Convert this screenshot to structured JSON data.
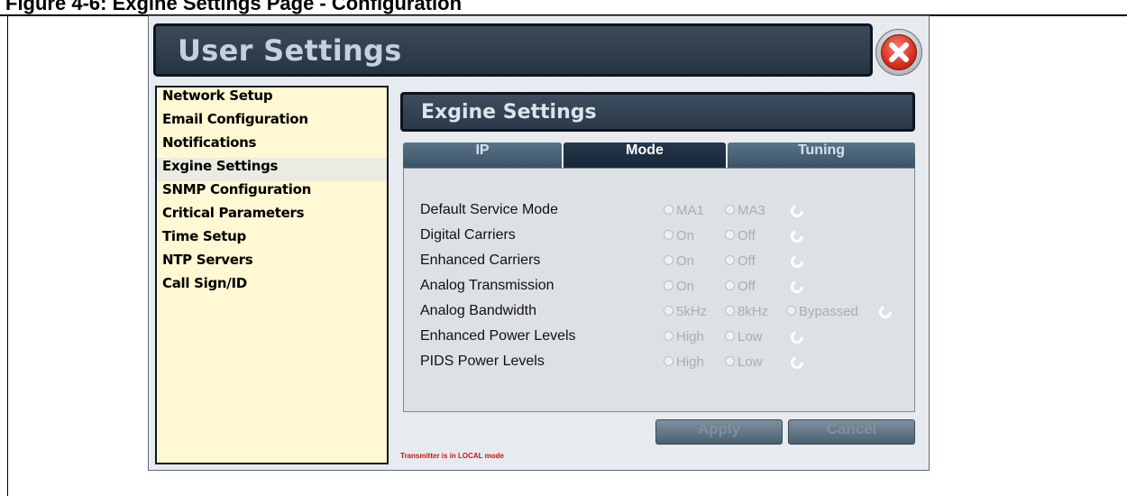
{
  "caption": "Figure 4-6: Exgine Settings Page - Configuration",
  "app": {
    "title": "User Settings",
    "close_icon": "close-icon"
  },
  "sidebar": {
    "items": [
      {
        "label": "Network Setup",
        "selected": false
      },
      {
        "label": "Email Configuration",
        "selected": false
      },
      {
        "label": "Notifications",
        "selected": false
      },
      {
        "label": "Exgine Settings",
        "selected": true
      },
      {
        "label": "SNMP Configuration",
        "selected": false
      },
      {
        "label": "Critical Parameters",
        "selected": false
      },
      {
        "label": "Time Setup",
        "selected": false
      },
      {
        "label": "NTP Servers",
        "selected": false
      },
      {
        "label": "Call Sign/ID",
        "selected": false
      }
    ]
  },
  "panel": {
    "title": "Exgine Settings",
    "tabs": [
      {
        "label": "IP",
        "active": false
      },
      {
        "label": "Mode",
        "active": true
      },
      {
        "label": "Tuning",
        "active": false
      }
    ],
    "rows": [
      {
        "label": "Default Service Mode",
        "options": [
          "MA1",
          "MA3"
        ]
      },
      {
        "label": "Digital Carriers",
        "options": [
          "On",
          "Off"
        ]
      },
      {
        "label": "Enhanced Carriers",
        "options": [
          "On",
          "Off"
        ]
      },
      {
        "label": "Analog Transmission",
        "options": [
          "On",
          "Off"
        ]
      },
      {
        "label": "Analog Bandwidth",
        "options": [
          "5kHz",
          "8kHz",
          "Bypassed"
        ]
      },
      {
        "label": "Enhanced Power Levels",
        "options": [
          "High",
          "Low"
        ]
      },
      {
        "label": "PIDS Power Levels",
        "options": [
          "High",
          "Low"
        ]
      }
    ],
    "apply_label": "Apply",
    "cancel_label": "Cancel",
    "status_message": "Transmitter is in LOCAL mode"
  },
  "colors": {
    "sidebar_bg": "#fff8d2",
    "title_bar": "#2f3d4d",
    "active_tab": "#1c2e40",
    "status_text": "#cc1111"
  }
}
